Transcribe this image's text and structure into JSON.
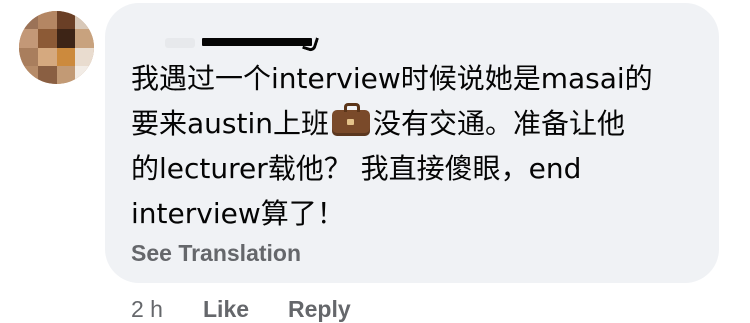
{
  "comment": {
    "lines": [
      "我遇过一个interview时候说她是masai的",
      "没有交通。准备让他",
      "的lecturer载他？ 我直接傻眼，end",
      "interview算了！"
    ],
    "line2_before_icon": "要来austin上班",
    "line2_icon": "briefcase-icon",
    "see_translation": "See Translation"
  },
  "actions": {
    "timestamp": "2 h",
    "like_label": "Like",
    "reply_label": "Reply"
  },
  "colors": {
    "bubble_bg": "#f0f2f5",
    "text": "#050505",
    "secondary_text": "#65676b"
  }
}
